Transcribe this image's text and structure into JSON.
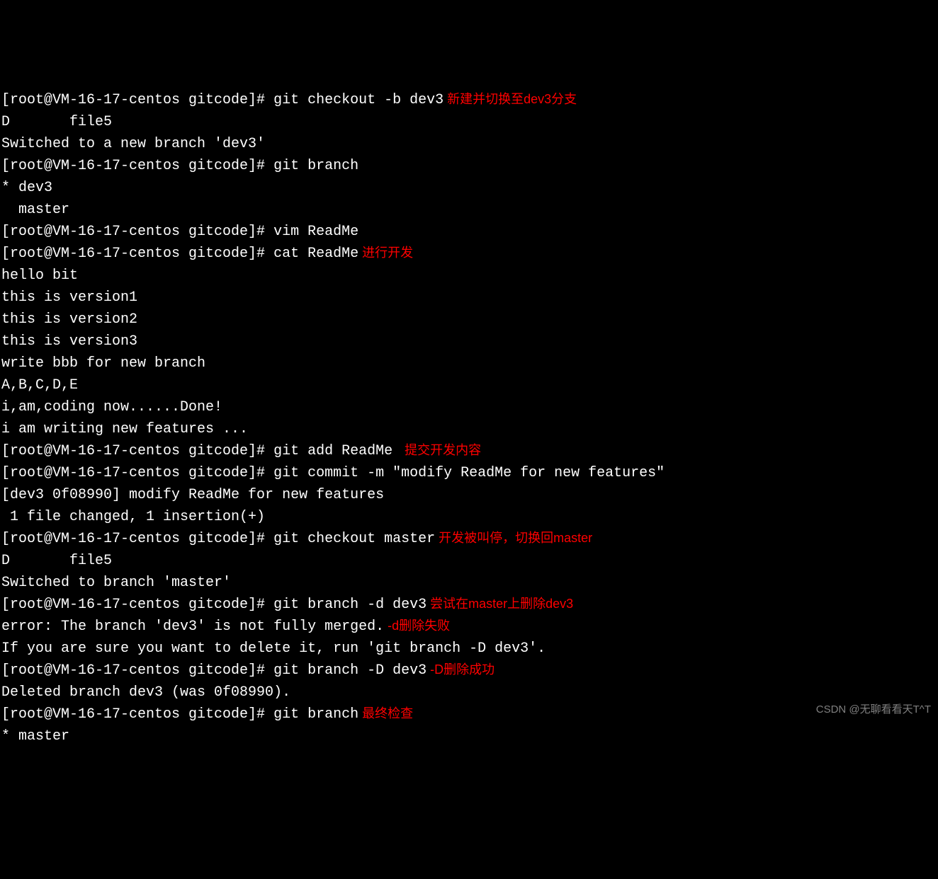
{
  "prompt": "[root@VM-16-17-centos gitcode]# ",
  "lines": [
    {
      "prompt": true,
      "cmd": "git checkout -b dev3",
      "note": " 新建并切换至dev3分支"
    },
    {
      "text": "D       file5"
    },
    {
      "text": "Switched to a new branch 'dev3'"
    },
    {
      "prompt": true,
      "cmd": "git branch"
    },
    {
      "text": "* dev3"
    },
    {
      "text": "  master"
    },
    {
      "prompt": true,
      "cmd": "vim ReadMe"
    },
    {
      "prompt": true,
      "cmd": "cat ReadMe",
      "note": " 进行开发"
    },
    {
      "text": "hello bit"
    },
    {
      "text": "this is version1"
    },
    {
      "text": "this is version2"
    },
    {
      "text": "this is version3"
    },
    {
      "text": "write bbb for new branch"
    },
    {
      "text": "A,B,C,D,E"
    },
    {
      "text": "i,am,coding now......Done!"
    },
    {
      "text": "i am writing new features ..."
    },
    {
      "prompt": true,
      "cmd": "git add ReadMe ",
      "note": " 提交开发内容"
    },
    {
      "prompt": true,
      "cmd": "git commit -m \"modify ReadMe for new features\""
    },
    {
      "text": "[dev3 0f08990] modify ReadMe for new features"
    },
    {
      "text": " 1 file changed, 1 insertion(+)"
    },
    {
      "prompt": true,
      "cmd": "git checkout master",
      "note": " 开发被叫停，切换回master"
    },
    {
      "text": "D       file5"
    },
    {
      "text": "Switched to branch 'master'"
    },
    {
      "prompt": true,
      "cmd": "git branch -d dev3",
      "note": " 尝试在master上删除dev3"
    },
    {
      "text": "error: The branch 'dev3' is not fully merged.",
      "note": " -d删除失败"
    },
    {
      "text": "If you are sure you want to delete it, run 'git branch -D dev3'."
    },
    {
      "prompt": true,
      "cmd": "git branch -D dev3",
      "note": " -D删除成功"
    },
    {
      "text": "Deleted branch dev3 (was 0f08990)."
    },
    {
      "prompt": true,
      "cmd": "git branch",
      "note": " 最终检查"
    },
    {
      "text": "* master"
    }
  ],
  "watermark": "CSDN @无聊看看天T^T"
}
